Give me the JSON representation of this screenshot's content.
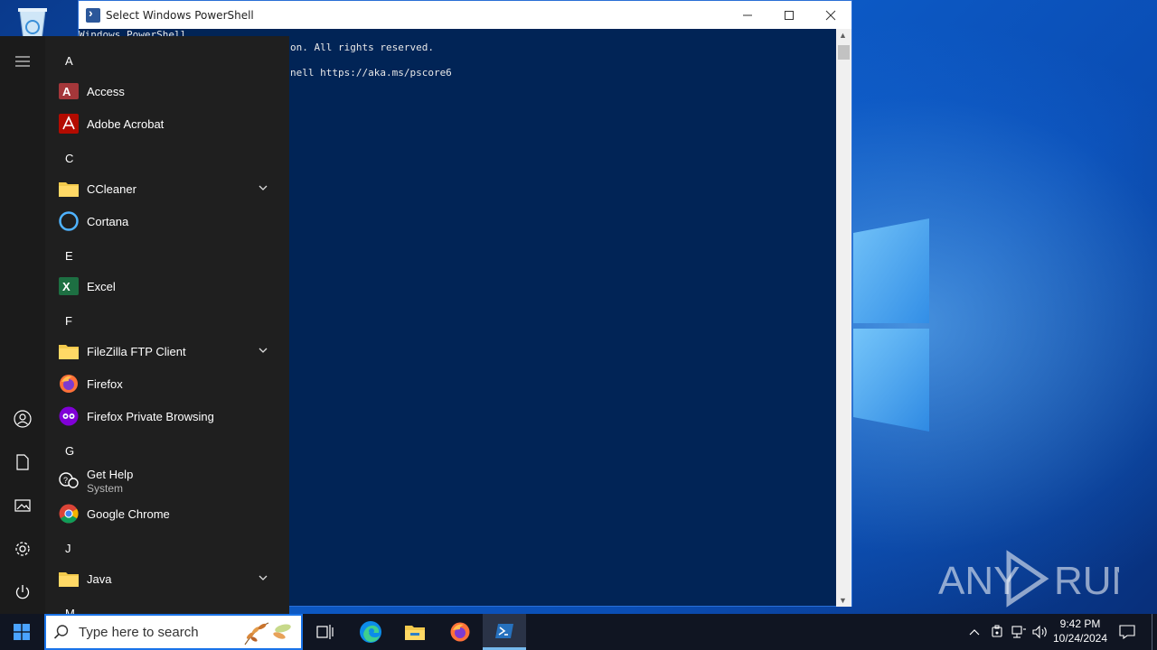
{
  "powershell": {
    "title": "Select Windows PowerShell",
    "lines": [
      "Windows PowerShell",
      "on. All rights reserved.",
      "nell https://aka.ms/pscore6"
    ]
  },
  "start_menu": {
    "groups": [
      {
        "letter": "A",
        "apps": [
          {
            "label": "Access",
            "icon": "access-icon"
          },
          {
            "label": "Adobe Acrobat",
            "icon": "acrobat-icon"
          }
        ]
      },
      {
        "letter": "C",
        "apps": [
          {
            "label": "CCleaner",
            "icon": "folder-icon",
            "expandable": true
          },
          {
            "label": "Cortana",
            "icon": "cortana-icon"
          }
        ]
      },
      {
        "letter": "E",
        "apps": [
          {
            "label": "Excel",
            "icon": "excel-icon"
          }
        ]
      },
      {
        "letter": "F",
        "apps": [
          {
            "label": "FileZilla FTP Client",
            "icon": "folder-icon",
            "expandable": true
          },
          {
            "label": "Firefox",
            "icon": "firefox-icon"
          },
          {
            "label": "Firefox Private Browsing",
            "icon": "firefox-private-icon"
          }
        ]
      },
      {
        "letter": "G",
        "apps": [
          {
            "label": "Get Help",
            "sublabel": "System",
            "icon": "get-help-icon"
          },
          {
            "label": "Google Chrome",
            "icon": "chrome-icon"
          }
        ]
      },
      {
        "letter": "J",
        "apps": [
          {
            "label": "Java",
            "icon": "folder-icon",
            "expandable": true
          }
        ]
      },
      {
        "letter": "M",
        "apps": []
      }
    ]
  },
  "taskbar": {
    "search_placeholder": "Type here to search",
    "time": "9:42 PM",
    "date": "10/24/2024"
  },
  "watermark": "ANY RUN"
}
